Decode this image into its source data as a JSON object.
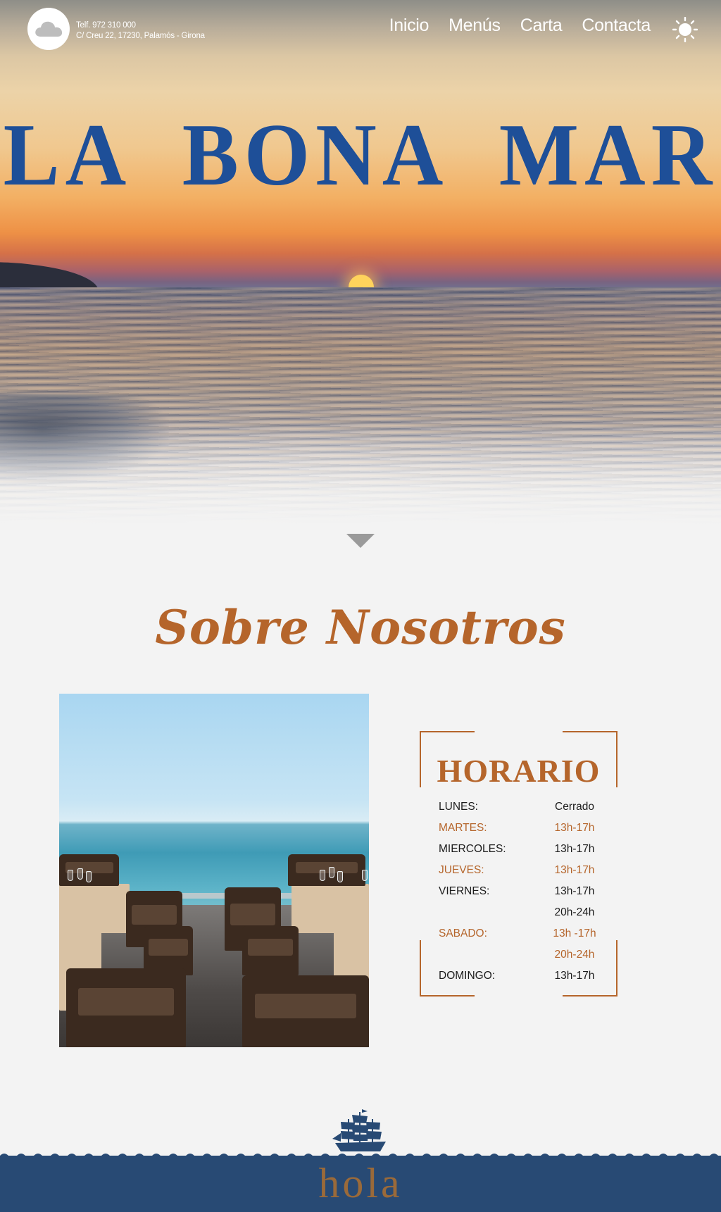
{
  "header": {
    "logo_icon": "cloud-icon",
    "phone": "Telf. 972 310 000",
    "address": "C/ Creu 22, 17230, Palamós - Girona",
    "nav": [
      {
        "label": "Inicio"
      },
      {
        "label": "Menús"
      },
      {
        "label": "Carta"
      },
      {
        "label": "Contacta"
      }
    ],
    "theme_icon": "sun-icon"
  },
  "hero": {
    "title": "LA BONA MAR",
    "scroll_icon": "chevron-down-icon"
  },
  "about": {
    "title": "Sobre Nosotros"
  },
  "schedule": {
    "title": "HORARIO",
    "rows": [
      {
        "day": "LUNES:",
        "time": "Cerrado",
        "accent": false
      },
      {
        "day": "MARTES:",
        "time": "13h-17h",
        "accent": true
      },
      {
        "day": "MIERCOLES:",
        "time": "13h-17h",
        "accent": false
      },
      {
        "day": "JUEVES:",
        "time": "13h-17h",
        "accent": true
      },
      {
        "day": "VIERNES:",
        "time": "13h-17h",
        "accent": false
      },
      {
        "day": "",
        "time": "20h-24h",
        "accent": false
      },
      {
        "day": "SABADO:",
        "time": "13h -17h",
        "accent": true
      },
      {
        "day": "",
        "time": "20h-24h",
        "accent": true
      },
      {
        "day": "DOMINGO:",
        "time": "13h-17h",
        "accent": false
      }
    ]
  },
  "footer": {
    "ship_icon": "ship-icon",
    "text": "hola"
  },
  "colors": {
    "accent": "#b5652b",
    "title_blue": "#1e4f98",
    "footer_blue": "#284a74"
  }
}
